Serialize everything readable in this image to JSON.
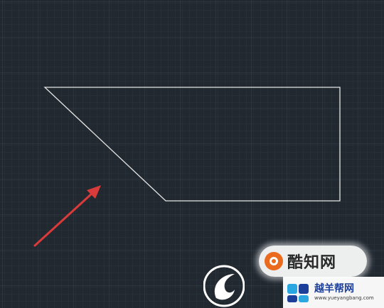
{
  "canvas": {
    "background": "#212830",
    "grid_minor_color": "#2b333c",
    "grid_major_color": "#38414b"
  },
  "drawing": {
    "shape": "trapezoid",
    "stroke_color": "#e6e6e6"
  },
  "annotation": {
    "icon": "arrow-icon",
    "color": "#d93a3a"
  },
  "watermarks": {
    "zhihu": {
      "text": "酷知网",
      "icon": "logo-badge-icon",
      "accent": "#ea6a1e"
    },
    "yueyang": {
      "title": "越羊帮网",
      "url": "www.yueyangbang.com",
      "icon": "logo-mark-icon",
      "accent": "#1c3f9a"
    },
    "swirl": {
      "icon": "swirl-logo-icon"
    }
  }
}
